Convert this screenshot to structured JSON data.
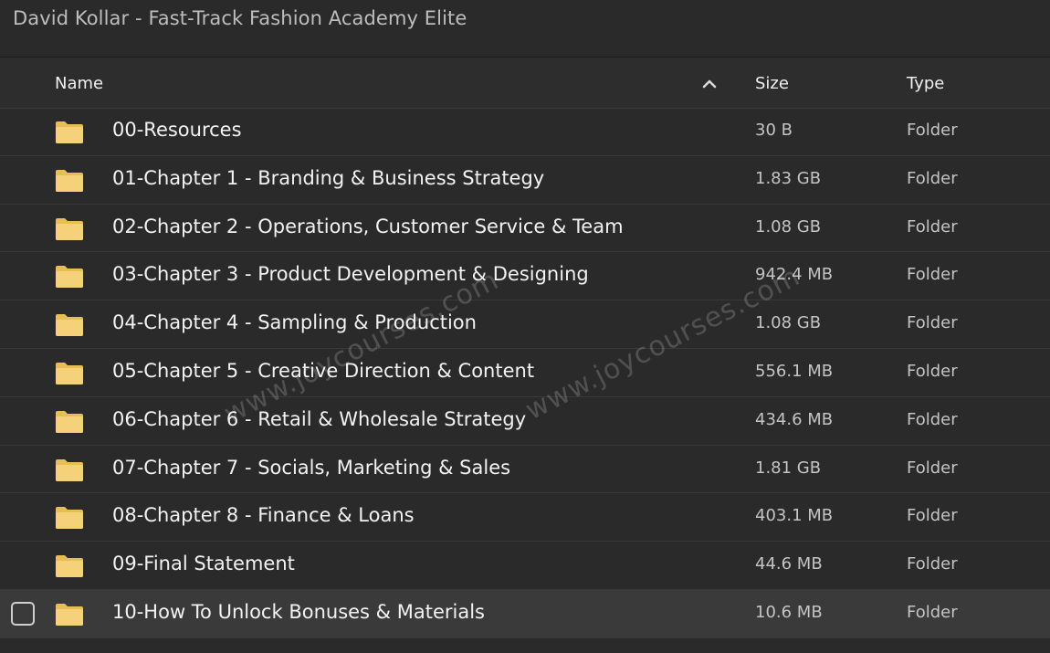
{
  "window": {
    "title": "David Kollar - Fast-Track Fashion Academy Elite"
  },
  "columns": {
    "name": "Name",
    "size": "Size",
    "type": "Type",
    "sort_icon": "chevron-up-icon"
  },
  "rows": [
    {
      "name": "00-Resources",
      "size": "30 B",
      "type": "Folder"
    },
    {
      "name": "01-Chapter 1 - Branding & Business Strategy",
      "size": "1.83 GB",
      "type": "Folder"
    },
    {
      "name": "02-Chapter 2 - Operations, Customer Service & Team",
      "size": "1.08 GB",
      "type": "Folder"
    },
    {
      "name": "03-Chapter 3 - Product Development & Designing",
      "size": "942.4 MB",
      "type": "Folder"
    },
    {
      "name": "04-Chapter 4 - Sampling & Production",
      "size": "1.08 GB",
      "type": "Folder"
    },
    {
      "name": "05-Chapter 5 - Creative Direction & Content",
      "size": "556.1 MB",
      "type": "Folder"
    },
    {
      "name": "06-Chapter 6 - Retail & Wholesale Strategy",
      "size": "434.6 MB",
      "type": "Folder"
    },
    {
      "name": "07-Chapter 7 - Socials, Marketing & Sales",
      "size": "1.81 GB",
      "type": "Folder"
    },
    {
      "name": "08-Chapter 8 - Finance & Loans",
      "size": "403.1 MB",
      "type": "Folder"
    },
    {
      "name": "09-Final Statement",
      "size": "44.6 MB",
      "type": "Folder"
    },
    {
      "name": "10-How To Unlock Bonuses & Materials",
      "size": "10.6 MB",
      "type": "Folder"
    }
  ],
  "watermarks": [
    "www.joycourses.com",
    "www.joycourses.com"
  ],
  "colors": {
    "background": "#2a2a2a",
    "folder": "#f5d27a",
    "folder_dark": "#e9bd55",
    "text": "#f2f2f2"
  }
}
